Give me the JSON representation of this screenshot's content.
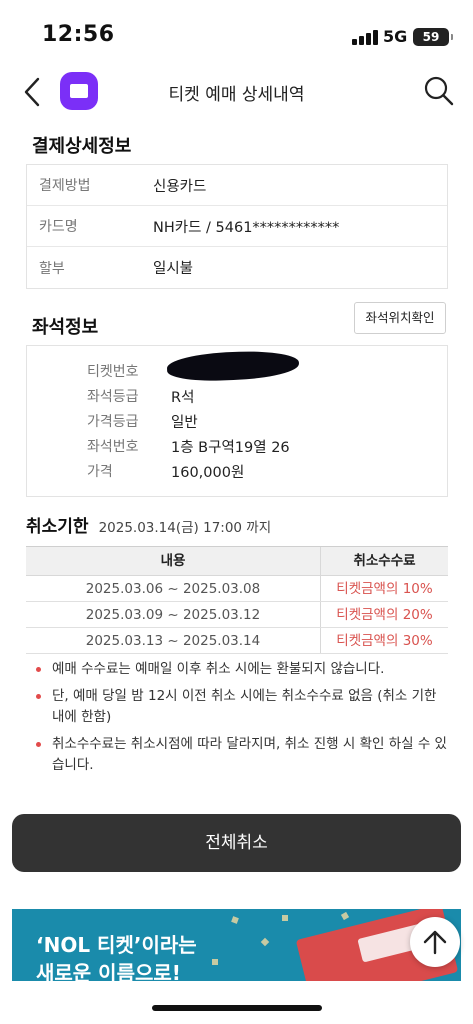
{
  "status_bar": {
    "time": "12:56",
    "network": "5G",
    "battery": "59"
  },
  "header": {
    "title": "티켓 예매 상세내역"
  },
  "payment": {
    "section_title": "결제상세정보",
    "rows": [
      {
        "label": "결제방법",
        "value": "신용카드"
      },
      {
        "label": "카드명",
        "value": "NH카드 / 5461************"
      },
      {
        "label": "할부",
        "value": "일시불"
      }
    ]
  },
  "seat": {
    "section_title": "좌석정보",
    "map_button": "좌석위치확인",
    "rows": [
      {
        "label": "티켓번호",
        "value": ""
      },
      {
        "label": "좌석등급",
        "value": "R석"
      },
      {
        "label": "가격등급",
        "value": "일반"
      },
      {
        "label": "좌석번호",
        "value": "1층 B구역19열 26"
      },
      {
        "label": "가격",
        "value": "160,000원"
      }
    ]
  },
  "cancellation": {
    "title": "취소기한",
    "deadline": "2025.03.14(금) 17:00 까지",
    "table": {
      "headers": [
        "내용",
        "취소수수료"
      ],
      "rows": [
        {
          "period": "2025.03.06 ~ 2025.03.08",
          "fee": "티켓금액의 10%"
        },
        {
          "period": "2025.03.09 ~ 2025.03.12",
          "fee": "티켓금액의 20%"
        },
        {
          "period": "2025.03.13 ~ 2025.03.14",
          "fee": "티켓금액의 30%"
        }
      ]
    },
    "notes": [
      "예매 수수료는 예매일 이후 취소 시에는 환불되지 않습니다.",
      "단, 예매 당일 밤 12시 이전 취소 시에는 취소수수료 없음 (취소 기한 내에 한함)",
      "취소수수료는 취소시점에 따라 달라지며, 취소 진행 시 확인 하실 수 있습니다."
    ],
    "cancel_all_button": "전체취소"
  },
  "banner": {
    "text_line1": "‘NOL 티켓’이라는",
    "text_line2": "새로운 이름으로!",
    "fee_color": "#d9534f",
    "brand_color": "#7b2ff7"
  }
}
